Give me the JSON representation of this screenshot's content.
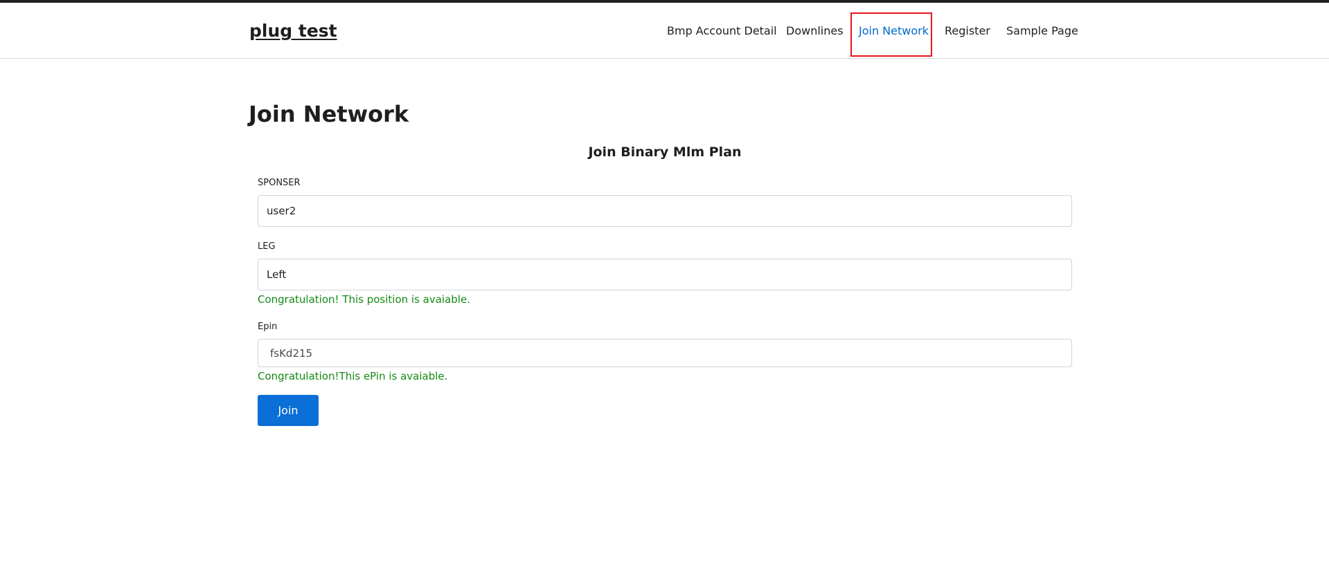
{
  "site": {
    "title": "plug test"
  },
  "nav": {
    "items": [
      {
        "label": "Bmp Account Detail"
      },
      {
        "label": "Downlines"
      },
      {
        "label": "Join Network"
      },
      {
        "label": "Register"
      },
      {
        "label": "Sample Page"
      }
    ],
    "active": "Join Network"
  },
  "page": {
    "title": "Join Network"
  },
  "form": {
    "title": "Join Binary Mlm Plan",
    "sponser": {
      "label": "SPONSER",
      "value": "user2"
    },
    "leg": {
      "label": "LEG",
      "value": "Left",
      "message": "Congratulation! This position is avaiable."
    },
    "epin": {
      "label": "Epin",
      "value": "fsKd215",
      "message": "Congratulation!This ePin is avaiable."
    },
    "join_label": "Join"
  },
  "colors": {
    "accent": "#0a6fd6",
    "active_nav": "#0068c9",
    "success": "#138a13",
    "highlight": "#e8141c"
  }
}
